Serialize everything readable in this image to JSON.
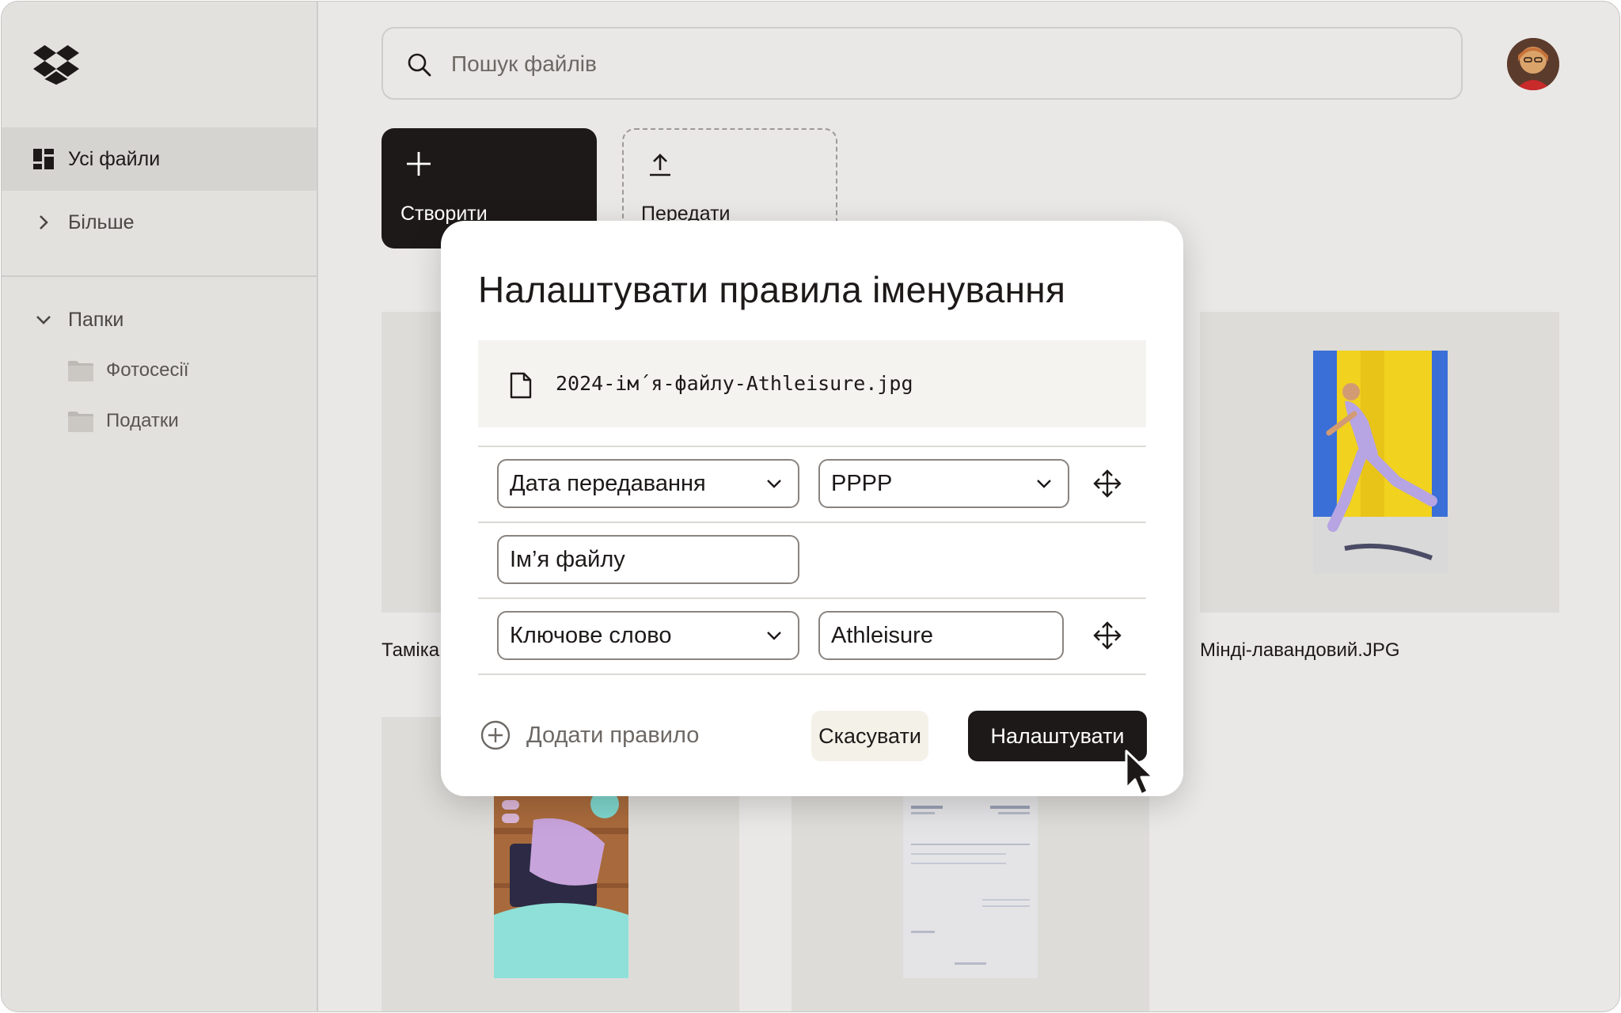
{
  "sidebar": {
    "items": [
      {
        "label": "Усі файли",
        "icon": "all-files-icon",
        "active": true
      },
      {
        "label": "Більше",
        "icon": "chevron-right-icon",
        "active": false
      }
    ],
    "folders_header": "Папки",
    "folders": [
      {
        "label": "Фотосесії",
        "icon": "folder-icon"
      },
      {
        "label": "Податки",
        "icon": "folder-icon"
      }
    ]
  },
  "search": {
    "placeholder": "Пошук файлів",
    "value": ""
  },
  "actions": {
    "create_label": "Створити",
    "upload_label": "Передати"
  },
  "files": [
    {
      "name": "Таміка"
    },
    {
      "name": "Мінді-лавандовий.JPG"
    }
  ],
  "modal": {
    "title": "Налаштувати правила іменування",
    "preview_filename": "2024-ім´я-файлу-Athleisure.jpg",
    "rules": [
      {
        "field": "Дата передавання",
        "option": "РРРР"
      },
      {
        "field": "Ім’я файлу"
      },
      {
        "field": "Ключове слово",
        "value": "Athleisure"
      }
    ],
    "add_rule_label": "Додати правило",
    "cancel_label": "Скасувати",
    "apply_label": "Налаштувати"
  },
  "colors": {
    "accent_dark": "#1e1919",
    "background": "#e9e8e6",
    "sidebar": "#e2e1de",
    "modal": "#ffffff"
  }
}
